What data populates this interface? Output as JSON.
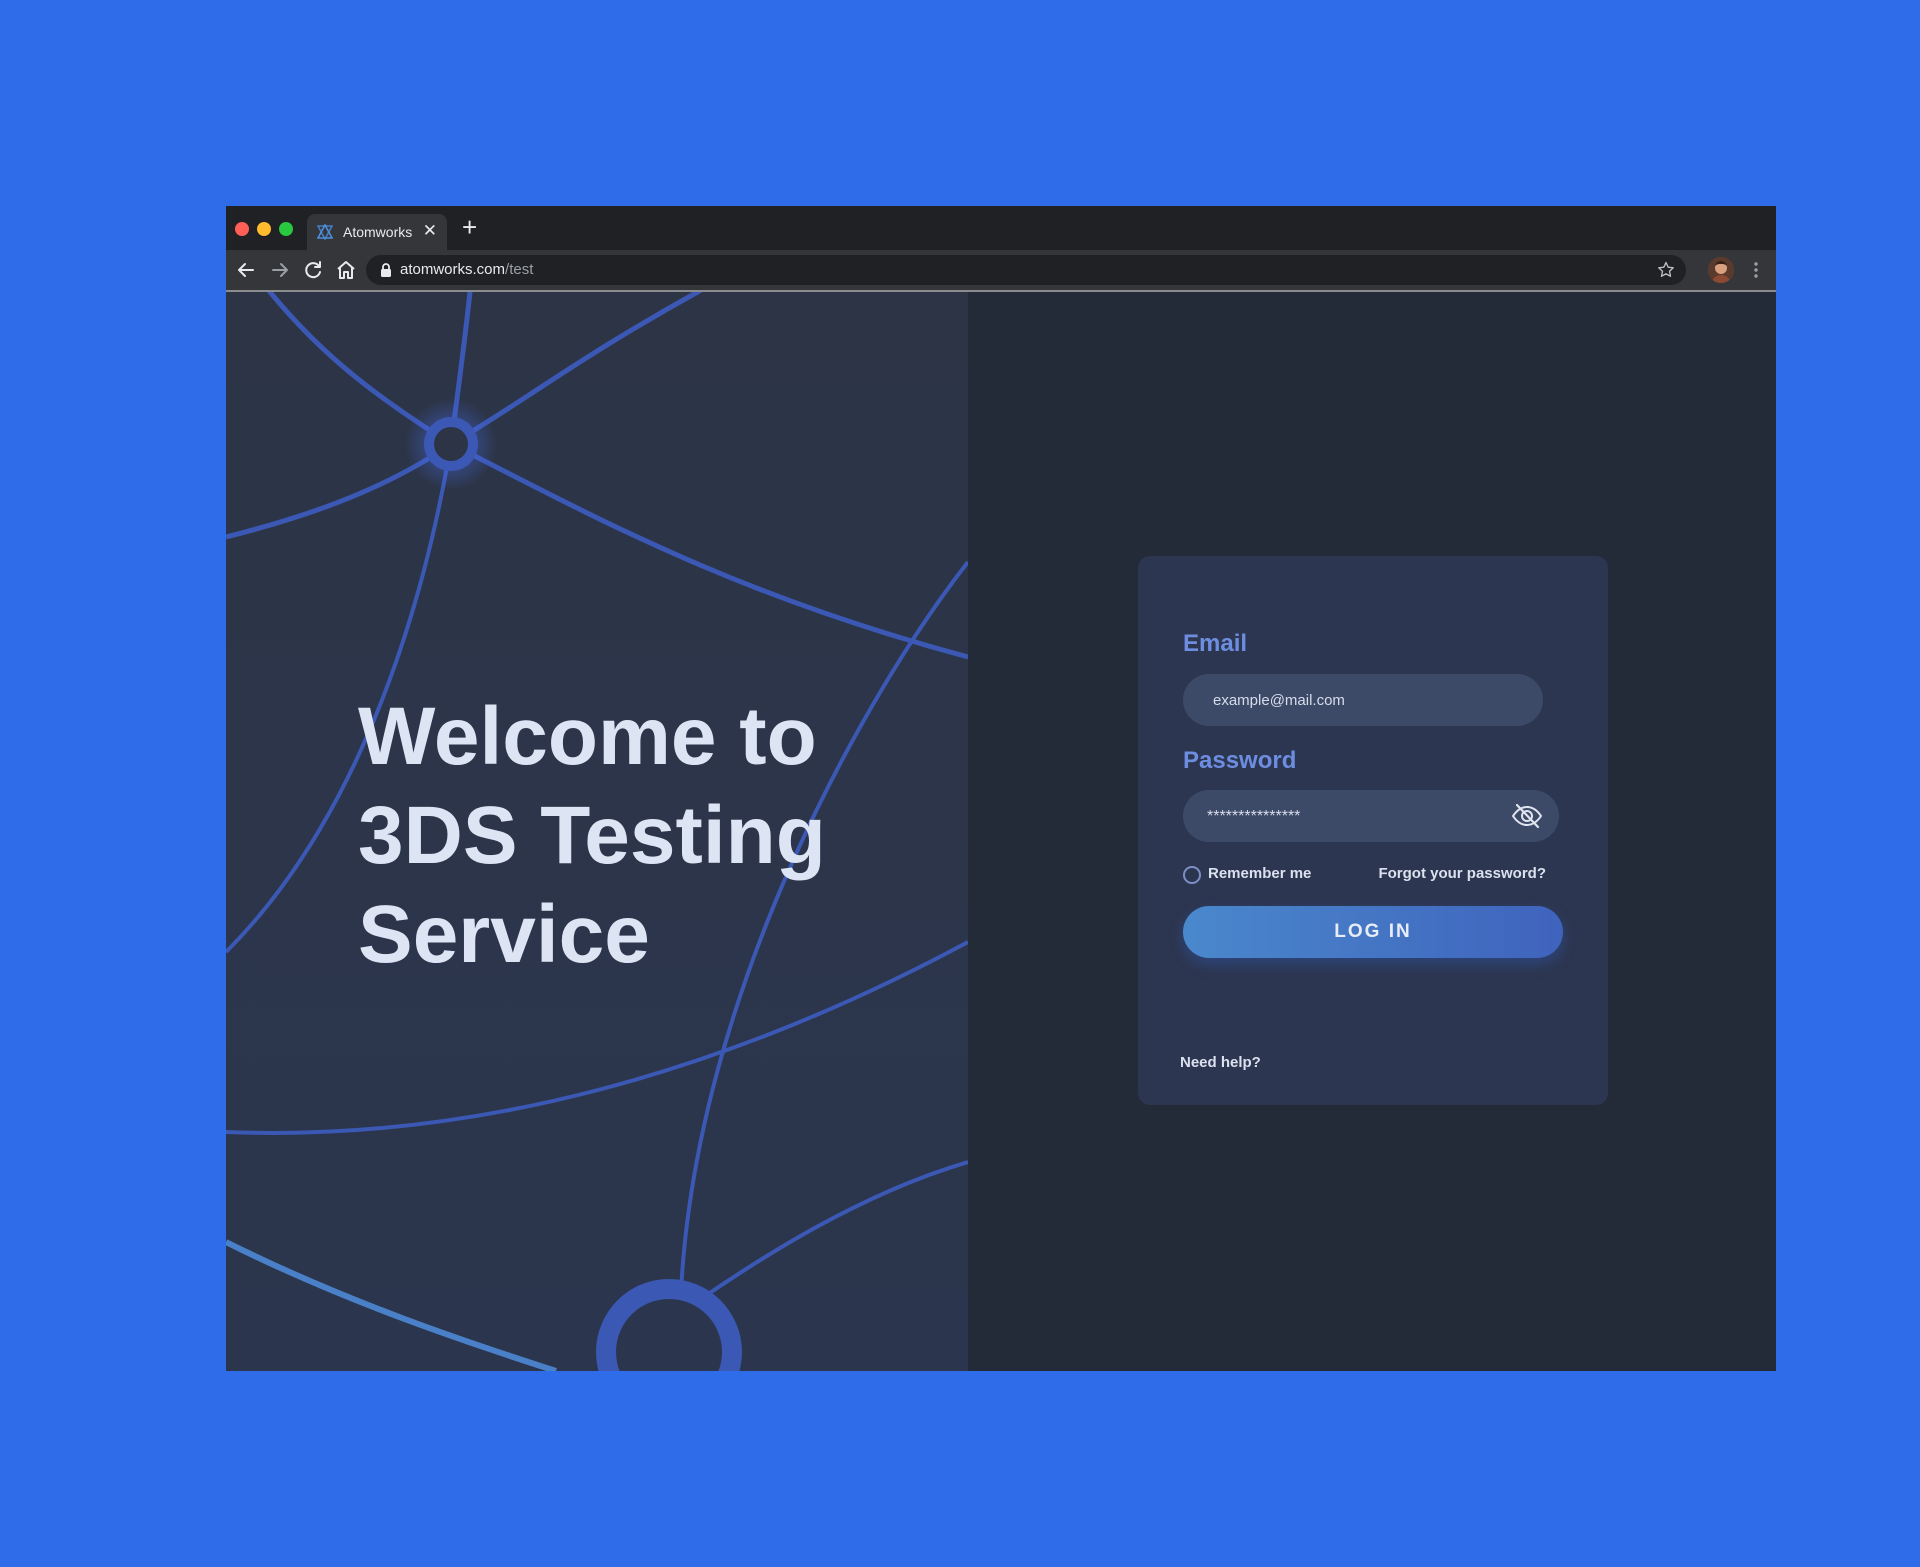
{
  "browser": {
    "tab_title": "Atomworks",
    "tab_close": "✕",
    "new_tab": "+",
    "url_domain": "atomworks.com",
    "url_path": "/test"
  },
  "hero": {
    "title_lines": [
      "Welcome to",
      "3DS Testing",
      "Service"
    ]
  },
  "login": {
    "email_label": "Email",
    "email_value": "example@mail.com",
    "password_label": "Password",
    "password_value": "***************",
    "remember_label": "Remember me",
    "forgot_label": "Forgot your password?",
    "login_button": "LOG IN",
    "help_label": "Need help?"
  },
  "colors": {
    "page_background": "#2e6ce9",
    "panel": "#2d3650",
    "accent": "#6d8ee0",
    "button_gradient_start": "#4a88cc",
    "button_gradient_end": "#3f63bd"
  },
  "icons": {
    "tab_favicon": "atom-logo-icon",
    "password_toggle": "eye-off-icon",
    "address_lock": "lock-icon",
    "bookmark": "star-icon"
  }
}
